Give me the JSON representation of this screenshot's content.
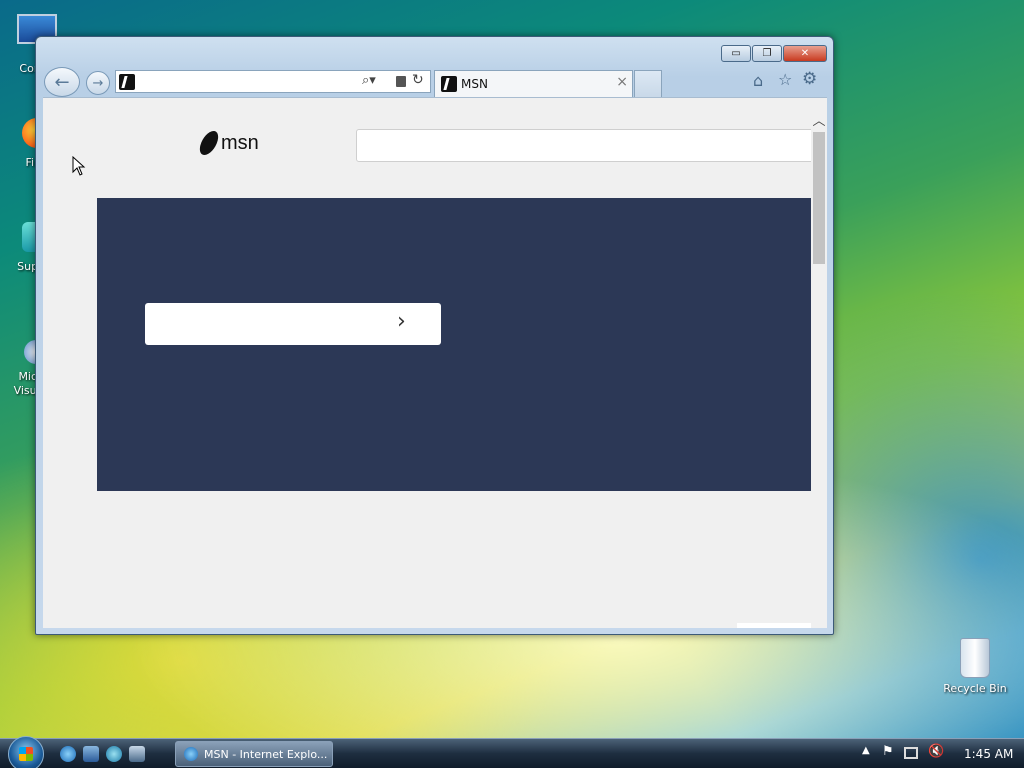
{
  "desktop": {
    "icons": [
      {
        "label": "Com",
        "icon": "computer-icon"
      },
      {
        "label": "Fir",
        "icon": "firefox-icon"
      },
      {
        "label": "Supe",
        "icon": "app-icon"
      },
      {
        "label": "Micr\nVisual",
        "icon": "visual-studio-icon"
      },
      {
        "label": "Recycle Bin",
        "icon": "recycle-bin-icon"
      }
    ]
  },
  "browser": {
    "tab": {
      "title": "MSN",
      "close_label": "×"
    },
    "address": {
      "value": "",
      "search_glyph": "⌕▾"
    },
    "caption": {
      "minimize": "▭",
      "maximize": "❐",
      "close": "✕"
    },
    "toolbar_icons": [
      "home-icon",
      "favorites-star-icon",
      "settings-gear-icon"
    ]
  },
  "page": {
    "logo_text": "msn",
    "search_placeholder": "",
    "hero_card_arrow": "›"
  },
  "taskbar": {
    "task_label": "MSN - Internet Explo...",
    "clock": "1:45 AM"
  },
  "colors": {
    "hero_bg": "#2c3856",
    "content_bg": "#f0f0f0"
  }
}
